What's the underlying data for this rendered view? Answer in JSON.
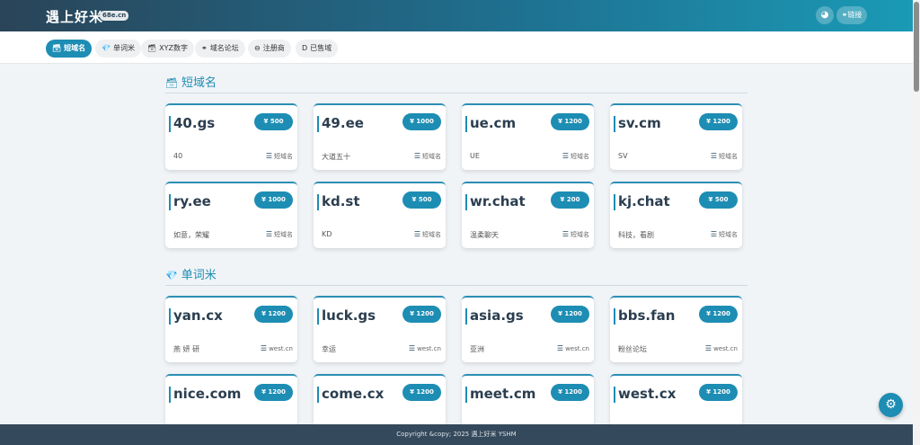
{
  "header": {
    "logo": "遇上好米",
    "logo_badge": "68e.cn",
    "palette_icon": "palette-icon",
    "link_label": "链接",
    "link_icon": "link-icon"
  },
  "nav": {
    "tabs": [
      {
        "icon": "🗃",
        "label": "短域名",
        "active": true
      },
      {
        "icon": "💎",
        "label": "单词米",
        "active": false
      },
      {
        "icon": "🗃",
        "label": "XYZ数字",
        "active": false
      },
      {
        "icon": "⚭",
        "label": "域名论坛",
        "active": false
      },
      {
        "icon": "⊖",
        "label": "注册商",
        "active": false
      },
      {
        "icon": "D",
        "label": "已售域",
        "active": false
      }
    ]
  },
  "sections": [
    {
      "icon": "🗃",
      "title": "短域名",
      "cards": [
        {
          "name": "40.gs",
          "price": "¥ 500",
          "desc": "40",
          "tag": "短域名"
        },
        {
          "name": "49.ee",
          "price": "¥ 1000",
          "desc": "大道五十",
          "tag": "短域名"
        },
        {
          "name": "ue.cm",
          "price": "¥ 1200",
          "desc": "UE",
          "tag": "短域名"
        },
        {
          "name": "sv.cm",
          "price": "¥ 1200",
          "desc": "SV",
          "tag": "短域名"
        },
        {
          "name": "ry.ee",
          "price": "¥ 1000",
          "desc": "如意，荣耀",
          "tag": "短域名"
        },
        {
          "name": "kd.st",
          "price": "¥ 500",
          "desc": "KD",
          "tag": "短域名"
        },
        {
          "name": "wr.chat",
          "price": "¥ 200",
          "desc": "温柔聊天",
          "tag": "短域名"
        },
        {
          "name": "kj.chat",
          "price": "¥ 500",
          "desc": "科技，看剧",
          "tag": "短域名"
        }
      ]
    },
    {
      "icon": "💎",
      "title": "单词米",
      "cards": [
        {
          "name": "yan.cx",
          "price": "¥ 1200",
          "desc": "燕 妍 研",
          "tag": "west.cn"
        },
        {
          "name": "luck.gs",
          "price": "¥ 1200",
          "desc": "幸运",
          "tag": "west.cn"
        },
        {
          "name": "asia.gs",
          "price": "¥ 1200",
          "desc": "亚洲",
          "tag": "west.cn"
        },
        {
          "name": "bbs.fan",
          "price": "¥ 1200",
          "desc": "粉丝论坛",
          "tag": "west.cn"
        },
        {
          "name": "nice.com",
          "price": "¥ 1200",
          "desc": "",
          "tag": ""
        },
        {
          "name": "come.cx",
          "price": "¥ 1200",
          "desc": "",
          "tag": ""
        },
        {
          "name": "meet.cm",
          "price": "¥ 1200",
          "desc": "",
          "tag": ""
        },
        {
          "name": "west.cx",
          "price": "¥ 1200",
          "desc": "",
          "tag": ""
        }
      ]
    }
  ],
  "footer": {
    "text": "Copyright &copy; 2025 遇上好米 YSHM"
  },
  "fab_icon": "gear-icon",
  "colors": {
    "accent": "#1d8db4",
    "header_start": "#2a4458",
    "header_end": "#1a9ab6",
    "footer": "#34495b"
  }
}
